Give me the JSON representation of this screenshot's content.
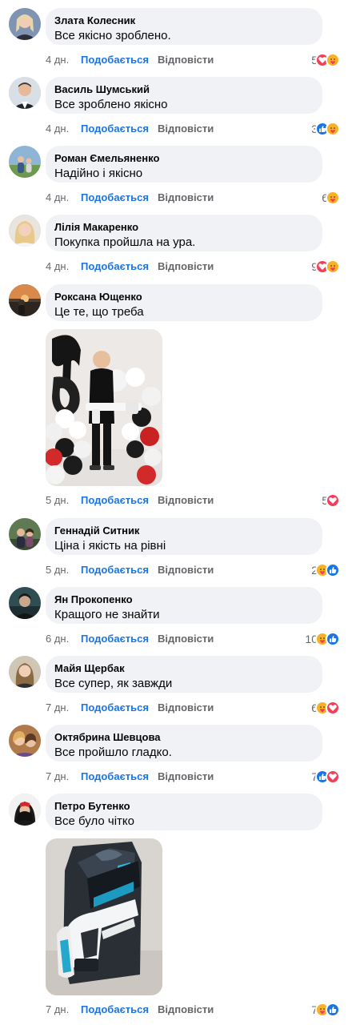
{
  "like_label": "Подобається",
  "reply_label": "Відповісти",
  "comments": [
    {
      "author": "Злата Колесник",
      "text": "Все якісно зроблено.",
      "time": "4 дн.",
      "count": "5",
      "reactions": [
        "heart-icon",
        "care-icon"
      ]
    },
    {
      "author": "Василь Шумський",
      "text": "Все зроблено якісно",
      "time": "4 дн.",
      "count": "3",
      "reactions": [
        "like-icon",
        "care-icon"
      ]
    },
    {
      "author": "Роман Ємельяненко",
      "text": "Надійно і якісно",
      "time": "4 дн.",
      "count": "6",
      "reactions": [
        "care-icon"
      ]
    },
    {
      "author": "Лілія Макаренко",
      "text": "Покупка пройшла на ура.",
      "time": "4 дн.",
      "count": "9",
      "reactions": [
        "heart-icon",
        "care-icon"
      ]
    },
    {
      "author": "Роксана Ющенко",
      "text": "Це те, що треба",
      "time": "5 дн.",
      "count": "5",
      "reactions": [
        "heart-icon"
      ],
      "photo": "child-birthday-photo"
    },
    {
      "author": "Геннадій Ситник",
      "text": "Ціна і якість на рівні",
      "time": "5 дн.",
      "count": "2",
      "reactions": [
        "care-icon",
        "like-icon"
      ]
    },
    {
      "author": "Ян Прокопенко",
      "text": "Кращого не знайти",
      "time": "6 дн.",
      "count": "10",
      "reactions": [
        "care-icon",
        "like-icon"
      ]
    },
    {
      "author": "Майя Щербак",
      "text": "Все супер, як завжди",
      "time": "7 дн.",
      "count": "6",
      "reactions": [
        "care-icon",
        "heart-icon"
      ]
    },
    {
      "author": "Октябрина Шевцова",
      "text": "Все пройшло гладко.",
      "time": "7 дн.",
      "count": "7",
      "reactions": [
        "like-icon",
        "heart-icon"
      ]
    },
    {
      "author": "Петро Бутенко",
      "text": "Все було чітко",
      "time": "7 дн.",
      "count": "7",
      "reactions": [
        "care-icon",
        "like-icon"
      ],
      "photo": "water-gun-box-photo"
    }
  ],
  "colors": {
    "like_blue": "#1b74e4",
    "heart_red": "#f33e58",
    "care_yellow": "#f7b125",
    "bubble_bg": "#f0f2f5",
    "meta_gray": "#65676b"
  }
}
